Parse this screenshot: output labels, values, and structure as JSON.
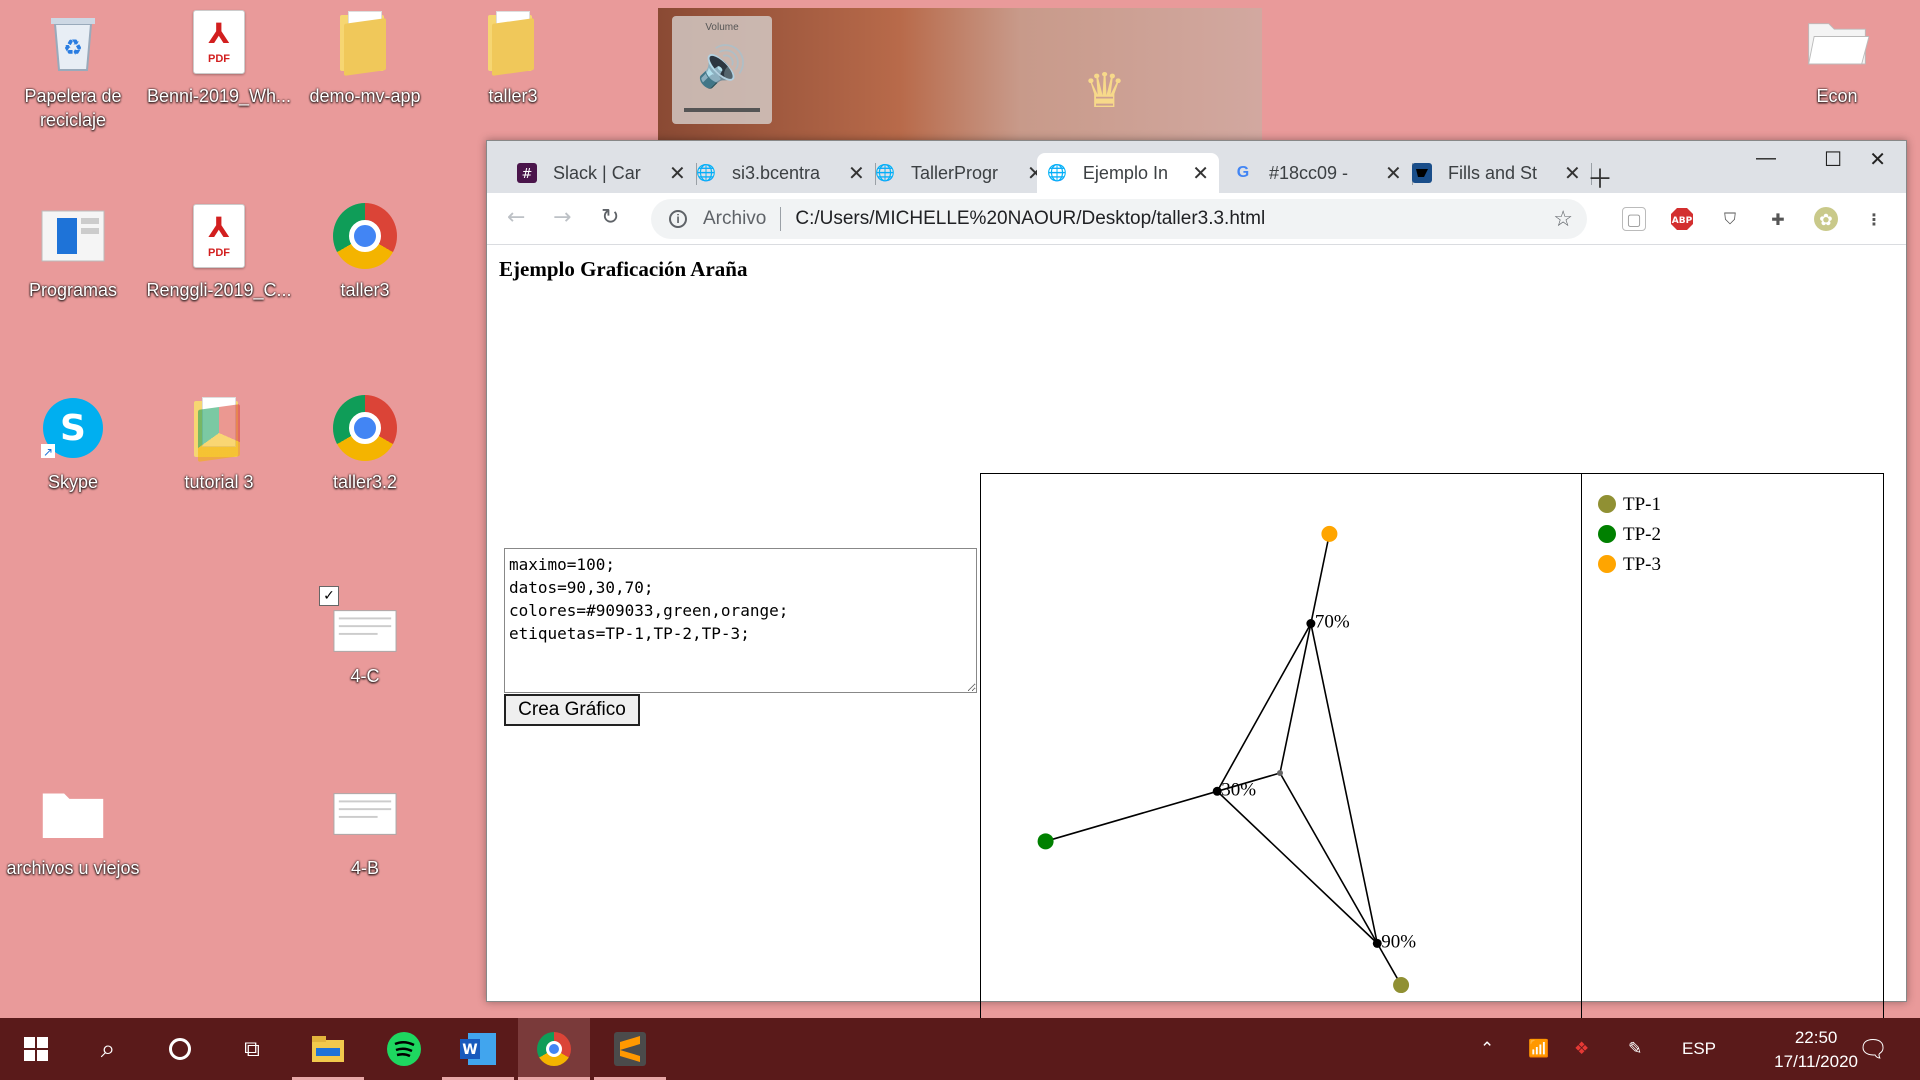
{
  "desktop": {
    "icons": [
      {
        "label": "Papelera de reciclaje",
        "icon": "recycle-bin-icon"
      },
      {
        "label": "Benni-2019_Wh...",
        "icon": "pdf-icon"
      },
      {
        "label": "demo-mv-app",
        "icon": "folder-icon"
      },
      {
        "label": "taller3",
        "icon": "folder-icon"
      },
      {
        "label": "Econ",
        "icon": "folder-icon"
      },
      {
        "label": "Programas",
        "icon": "shortcut-icon"
      },
      {
        "label": "Renggli-2019_C...",
        "icon": "pdf-icon"
      },
      {
        "label": "taller3",
        "icon": "chrome-icon"
      },
      {
        "label": "Skype",
        "icon": "skype-icon"
      },
      {
        "label": "tutorial 3",
        "icon": "folder-icon"
      },
      {
        "label": "taller3.2",
        "icon": "chrome-icon"
      },
      {
        "label": "4-C",
        "icon": "file-icon"
      },
      {
        "label": "archivos u viejos",
        "icon": "folder-icon"
      },
      {
        "label": "4-B",
        "icon": "file-icon"
      }
    ],
    "volume_label": "Volume"
  },
  "browser": {
    "tabs": [
      {
        "title": "Slack | Car",
        "icon": "slack-icon"
      },
      {
        "title": "si3.bcentra",
        "icon": "globe-icon"
      },
      {
        "title": "TallerProgr",
        "icon": "globe-icon"
      },
      {
        "title": "Ejemplo In",
        "icon": "globe-icon",
        "active": true
      },
      {
        "title": "#18cc09 -",
        "icon": "google-icon"
      },
      {
        "title": "Fills and St",
        "icon": "d3-icon"
      }
    ],
    "address": {
      "scheme_label": "Archivo",
      "url": "C:/Users/MICHELLE%20NAOUR/Desktop/taller3.3.html"
    }
  },
  "page": {
    "heading": "Ejemplo Graficación Araña",
    "textarea": "maximo=100;\ndatos=90,30,70;\ncolores=#909033,green,orange;\netiquetas=TP-1,TP-2,TP-3;",
    "button": "Crea Gráfico"
  },
  "chart_data": {
    "type": "radar",
    "maximum": 100,
    "values": [
      90,
      30,
      70
    ],
    "value_labels": [
      "90%",
      "30%",
      "70%"
    ],
    "series": [
      {
        "name": "TP-1",
        "value": 90,
        "color": "#909033"
      },
      {
        "name": "TP-2",
        "value": 30,
        "color": "green"
      },
      {
        "name": "TP-3",
        "value": 70,
        "color": "orange"
      }
    ]
  },
  "taskbar": {
    "language": "ESP",
    "time": "22:50",
    "date": "17/11/2020"
  }
}
